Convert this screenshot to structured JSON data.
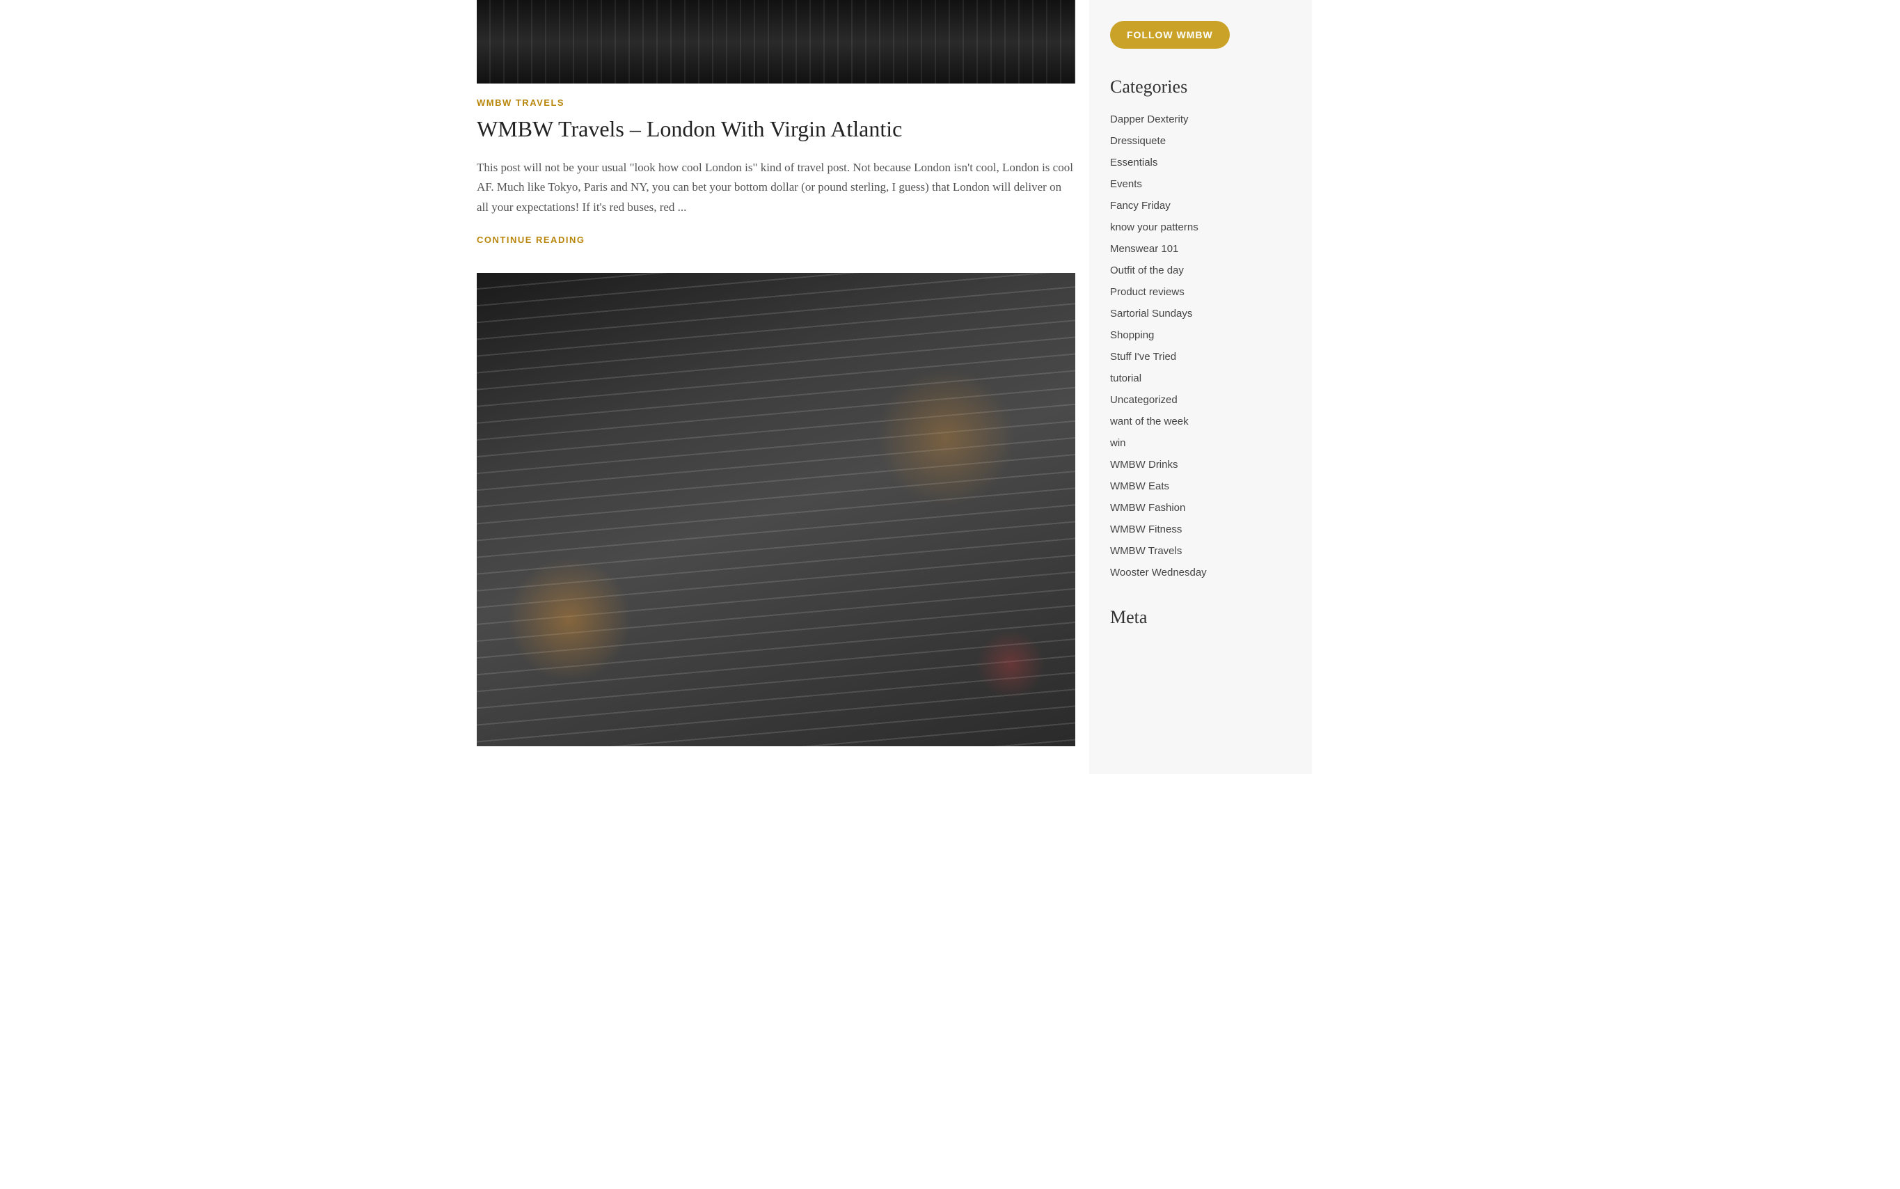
{
  "article": {
    "category": "WMBW TRAVELS",
    "title": "WMBW Travels – London With Virgin Atlantic",
    "excerpt": "This post will not be your usual \"look how cool London is\" kind of travel post. Not because London isn't cool, London is cool AF.  Much like Tokyo, Paris and NY, you can bet your bottom dollar (or pound sterling, I guess) that London will deliver on all your expectations! If it's red buses, red ...",
    "continue_reading": "CONTINUE READING"
  },
  "sidebar": {
    "follow_button": "FOLLOW WMBW",
    "categories_title": "Categories",
    "categories": [
      "Dapper Dexterity",
      "Dressiquete",
      "Essentials",
      "Events",
      "Fancy Friday",
      "know your patterns",
      "Menswear 101",
      "Outfit of the day",
      "Product reviews",
      "Sartorial Sundays",
      "Shopping",
      "Stuff I've Tried",
      "tutorial",
      "Uncategorized",
      "want of the week",
      "win",
      "WMBW Drinks",
      "WMBW Eats",
      "WMBW Fashion",
      "WMBW Fitness",
      "WMBW Travels",
      "Wooster Wednesday"
    ],
    "meta_title": "Meta"
  }
}
